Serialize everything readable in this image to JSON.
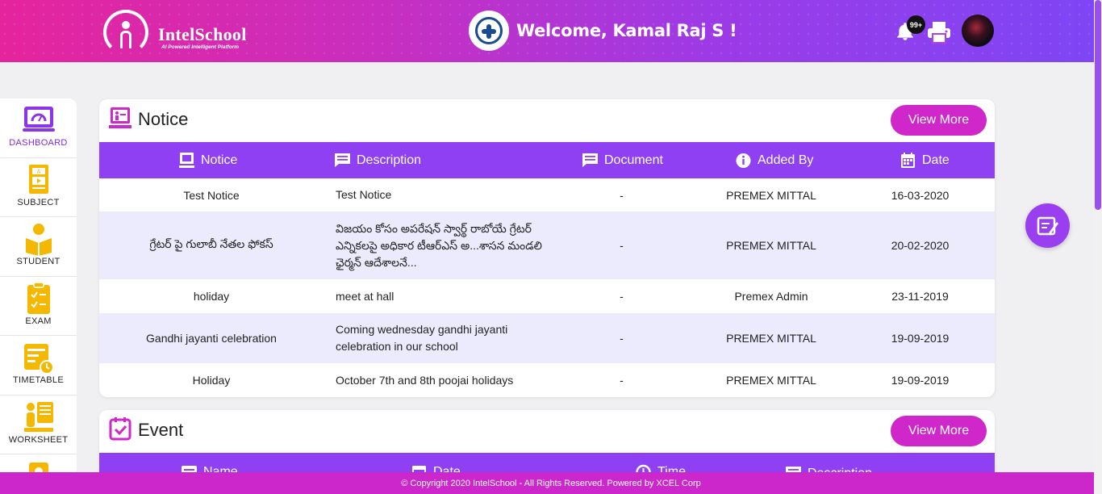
{
  "header": {
    "logo_name": "IntelSchool",
    "logo_tagline": "AI Powered Intelligent Platform",
    "welcome": "Welcome, Kamal Raj S !",
    "notification_count": "99+"
  },
  "sidebar": {
    "items": [
      {
        "label": "DASHBOARD",
        "icon": "dashboard-icon",
        "active": true
      },
      {
        "label": "SUBJECT",
        "icon": "subject-icon"
      },
      {
        "label": "STUDENT",
        "icon": "student-icon"
      },
      {
        "label": "EXAM",
        "icon": "exam-icon"
      },
      {
        "label": "TIMETABLE",
        "icon": "timetable-icon"
      },
      {
        "label": "WORKSHEET",
        "icon": "worksheet-icon"
      },
      {
        "label": "",
        "icon": "idea-icon"
      }
    ]
  },
  "notice": {
    "title": "Notice",
    "view_more": "View More",
    "columns": {
      "notice": "Notice",
      "description": "Description",
      "document": "Document",
      "added_by": "Added By",
      "date": "Date"
    },
    "rows": [
      {
        "notice": "Test Notice",
        "description": "Test Notice",
        "document": "-",
        "added_by": "PREMEX MITTAL",
        "date": "16-03-2020"
      },
      {
        "notice": "గ్రేటర్ పై గులాబీ నేతల ఫోకస్",
        "description": "విజయం కోసం అపరేషన్ స్వార్థ్ రాబోయే గ్రేటర్ ఎన్నికలపై అధికార టీఆర్ఎస్ అ...శాసన మండలి ఛైర్మన్ ఆదేశాలనే...",
        "document": "-",
        "added_by": "PREMEX MITTAL",
        "date": "20-02-2020"
      },
      {
        "notice": "holiday",
        "description": "meet at hall",
        "document": "-",
        "added_by": "Premex Admin",
        "date": "23-11-2019"
      },
      {
        "notice": "Gandhi jayanti celebration",
        "description": "Coming wednesday gandhi jayanti celebration in our school",
        "document": "-",
        "added_by": "PREMEX MITTAL",
        "date": "19-09-2019"
      },
      {
        "notice": "Holiday",
        "description": "October 7th and 8th poojai holidays",
        "document": "-",
        "added_by": "PREMEX MITTAL",
        "date": "19-09-2019"
      }
    ]
  },
  "event": {
    "title": "Event",
    "view_more": "View More",
    "columns": {
      "name": "Name",
      "date": "Date",
      "time": "Time",
      "description": "Description"
    }
  },
  "footer": {
    "text": "© Copyright 2020 IntelSchool - All Rights Reserved. Powered by XCEL Corp"
  },
  "colors": {
    "accent": "#8f40f2",
    "button": "#cf27c9",
    "alt_row": "#eceafd",
    "sidebar_icon": "#f5b800"
  }
}
